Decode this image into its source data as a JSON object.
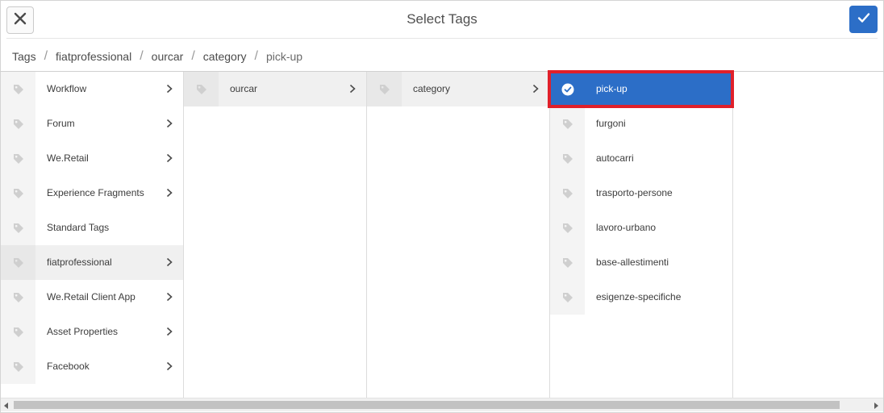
{
  "header": {
    "title": "Select Tags",
    "close_icon": "close-icon",
    "confirm_icon": "checkmark-icon",
    "accent": "#2c6ec7"
  },
  "breadcrumb": [
    "Tags",
    "fiatprofessional",
    "ourcar",
    "category",
    "pick-up"
  ],
  "columns": {
    "col1": [
      {
        "label": "Workflow",
        "has_children": true
      },
      {
        "label": "Forum",
        "has_children": true
      },
      {
        "label": "We.Retail",
        "has_children": true
      },
      {
        "label": "Experience Fragments",
        "has_children": true
      },
      {
        "label": "Standard Tags",
        "has_children": false
      },
      {
        "label": "fiatprofessional",
        "has_children": true,
        "active": true
      },
      {
        "label": "We.Retail Client App",
        "has_children": true
      },
      {
        "label": "Asset Properties",
        "has_children": true
      },
      {
        "label": "Facebook",
        "has_children": true
      }
    ],
    "col2": [
      {
        "label": "ourcar",
        "has_children": true,
        "active": true
      }
    ],
    "col3": [
      {
        "label": "category",
        "has_children": true,
        "active": true
      }
    ],
    "col4": [
      {
        "label": "pick-up",
        "selected": true
      },
      {
        "label": "furgoni"
      },
      {
        "label": "autocarri"
      },
      {
        "label": "trasporto-persone"
      },
      {
        "label": "lavoro-urbano"
      },
      {
        "label": "base-allestimenti"
      },
      {
        "label": "esigenze-specifiche"
      }
    ]
  },
  "colors": {
    "selected_bg": "#2c6ec7",
    "highlight_border": "#e0202a"
  }
}
